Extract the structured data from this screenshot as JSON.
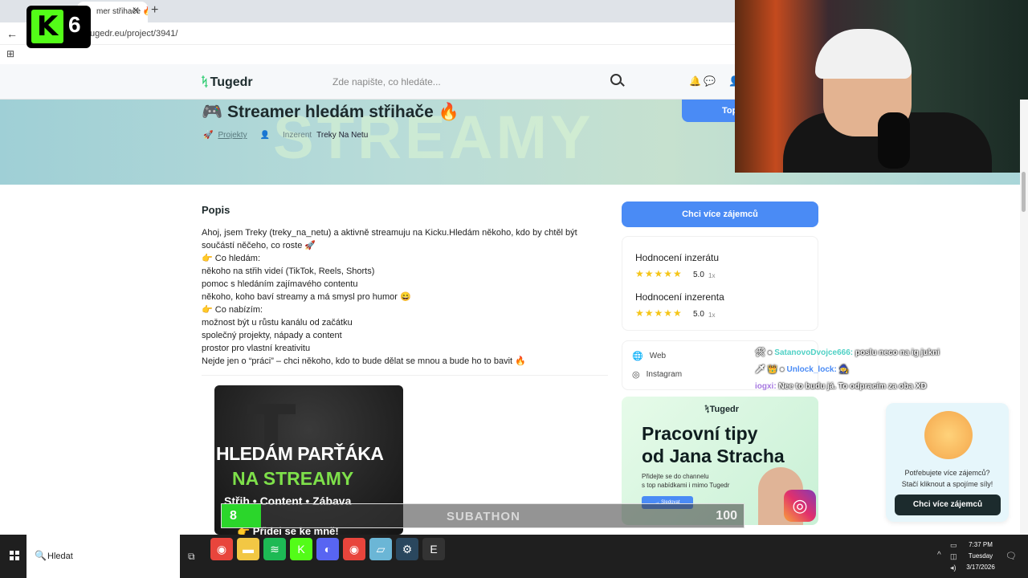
{
  "browser": {
    "tab_title": "mer střihače 🔥",
    "tab_close": "✕",
    "new_tab": "+",
    "back": "←",
    "url": "ugedr.eu/project/3941/",
    "apps_icon": "⊞"
  },
  "kick_overlay": {
    "logo": "K",
    "number": "6"
  },
  "site": {
    "logo_mark": "ᛪ",
    "logo": "Tugedr",
    "search_placeholder": "Zde napište, co hledáte...",
    "bell_icon": "🔔",
    "chat_icon": "💬",
    "user_icon": "👤"
  },
  "hero": {
    "bg_text": "STREAMY",
    "title": "🎮 Streamer hledám střihače 🔥",
    "breadcrumb_icon": "🚀",
    "breadcrumb_link": "Projekty",
    "breadcrumb_user_icon": "👤",
    "breadcrumb_label": "Inzerent",
    "breadcrumb_name": "Treky Na Netu",
    "top_button": "Top"
  },
  "description": {
    "heading": "Popis",
    "lines": [
      "Ahoj, jsem Treky (treky_na_netu) a aktivně streamuju na Kicku.Hledám někoho, kdo by chtěl být",
      "součástí něčeho, co roste 🚀",
      "👉 Co hledám:",
      "někoho na střih videí (TikTok, Reels, Shorts)",
      "pomoc s hledáním zajímavého contentu",
      "někoho, koho baví streamy a má smysl pro humor 😄",
      "👉 Co nabízím:",
      "možnost být u růstu kanálu od začátku",
      "společný projekty, nápady a content",
      "prostor pro vlastní kreativitu",
      "Nejde jen o “práci” – chci někoho, kdo to bude dělat se mnou a bude ho to bavit 🔥"
    ]
  },
  "promo_image": {
    "bg_letter": "T",
    "line1": "HLEDÁM PARŤÁKA",
    "line2": "NA STREAMY",
    "line3": "Střih • Content • Zábava",
    "line4": "👉 Přidej se ke mně!"
  },
  "sidebar": {
    "cta": "Chci více zájemců",
    "ratings": [
      {
        "title": "Hodnocení inzerátu",
        "stars": "★★★★★",
        "score": "5.0",
        "count": "1x"
      },
      {
        "title": "Hodnocení inzerenta",
        "stars": "★★★★★",
        "score": "5.0",
        "count": "1x"
      }
    ],
    "links": [
      {
        "icon": "🌐",
        "label": "Web"
      },
      {
        "icon": "◎",
        "label": "Instagram"
      }
    ],
    "ad": {
      "logo": "ᛪTugedr",
      "title_line1": "Pracovní tipy",
      "title_line2": "od Jana Stracha",
      "sub_line1": "Přidejte se do channelu",
      "sub_line2": "s top nabídkami i mimo Tugedr",
      "button": "→ Sledovat",
      "insta_icon": "◎"
    }
  },
  "chat": [
    {
      "badges": "🛠 ●",
      "user": "SatanovoDvojce666:",
      "message": "poslu neco na ig jukni"
    },
    {
      "badges": "🗡 👑 ●",
      "user": "Unlock_lock:",
      "message": "🧙"
    },
    {
      "badges": "",
      "user": "iogxi:",
      "message": "Nee to budu já. To odpracím za oba XD"
    }
  ],
  "help_widget": {
    "text_line1": "Potřebujete více zájemců?",
    "text_line2": "Stačí kliknout a spojíme síly!",
    "button": "Chci více zájemců"
  },
  "subathon": {
    "label": "SUBATHON",
    "start_value": "8",
    "end_value": "100",
    "progress": 0.075,
    "fill_color": "#2bd62b"
  },
  "taskbar": {
    "search_icon": "🔍",
    "search_text": "Hledat",
    "taskview_icon": "⧉",
    "apps": [
      {
        "name": "chrome-icon",
        "glyph": "◉",
        "color": "#e8453c"
      },
      {
        "name": "explorer-icon",
        "glyph": "▬",
        "color": "#f2c744"
      },
      {
        "name": "spotify-icon",
        "glyph": "≋",
        "color": "#1db954"
      },
      {
        "name": "kick-app-icon",
        "glyph": "K",
        "color": "#53fc18"
      },
      {
        "name": "discord-icon",
        "glyph": "◐",
        "color": "#5865f2"
      },
      {
        "name": "chrome-icon",
        "glyph": "◉",
        "color": "#e8453c"
      },
      {
        "name": "notes-icon",
        "glyph": "▱",
        "color": "#6bb6d6"
      },
      {
        "name": "steam-icon",
        "glyph": "⚙",
        "color": "#2a475e"
      },
      {
        "name": "epic-icon",
        "glyph": "E",
        "color": "#333333"
      }
    ],
    "tray_up": "^",
    "clock_time": "7:37 PM",
    "clock_day": "Tuesday",
    "clock_date": "3/17/2026",
    "notif_icon": "🗨"
  }
}
